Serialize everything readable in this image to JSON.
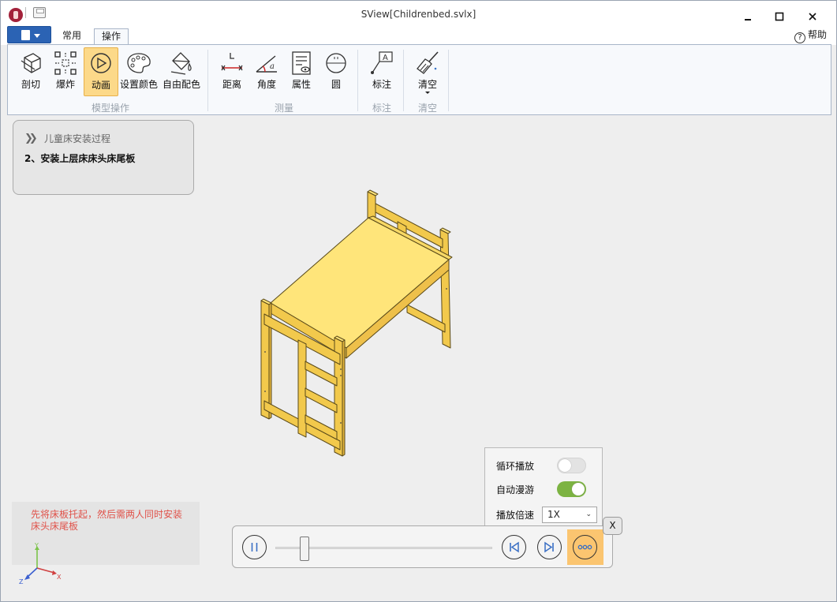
{
  "window": {
    "title": "SView[Childrenbed.svlx]",
    "minimize_icon": "minimize-icon",
    "maximize_icon": "maximize-icon",
    "close_icon": "close-icon"
  },
  "tabs": [
    {
      "label": "常用",
      "active": false
    },
    {
      "label": "操作",
      "active": true
    }
  ],
  "help_label": "帮助",
  "ribbon": {
    "groups": [
      {
        "label": "模型操作",
        "buttons": [
          {
            "label": "剖切",
            "icon": "section-cut-icon"
          },
          {
            "label": "爆炸",
            "icon": "explode-icon"
          },
          {
            "label": "动画",
            "icon": "animation-play-icon",
            "active": true
          },
          {
            "label": "设置颜色",
            "icon": "palette-icon"
          },
          {
            "label": "自由配色",
            "icon": "paint-bucket-icon"
          }
        ]
      },
      {
        "label": "测量",
        "buttons": [
          {
            "label": "距离",
            "icon": "distance-measure-icon"
          },
          {
            "label": "角度",
            "icon": "angle-measure-icon"
          },
          {
            "label": "属性",
            "icon": "properties-icon"
          },
          {
            "label": "圆",
            "icon": "circle-measure-icon"
          }
        ]
      },
      {
        "label": "标注",
        "buttons": [
          {
            "label": "标注",
            "icon": "annotation-icon"
          }
        ]
      },
      {
        "label": "清空",
        "buttons": [
          {
            "label": "清空",
            "icon": "broom-icon",
            "dropdown": true
          }
        ]
      }
    ]
  },
  "process": {
    "title": "儿童床安装过程",
    "step": "2、安装上层床床头床尾板"
  },
  "note": "先将床板托起，然后需两人同时安装床头床尾板",
  "axis_labels": {
    "x": "X",
    "y": "Y",
    "z": "Z"
  },
  "settings": {
    "loop_label": "循环播放",
    "loop_on": false,
    "roam_label": "自动漫游",
    "roam_on": true,
    "speed_label": "播放倍速",
    "speed_value": "1X"
  },
  "player": {
    "close_label": "X",
    "progress": 0.14
  },
  "colors": {
    "accent": "#fcd989",
    "bed_top": "#ffe57a",
    "bed_side": "#f2c94c",
    "note_text": "#e0524a",
    "toggle_on": "#7cb342"
  }
}
